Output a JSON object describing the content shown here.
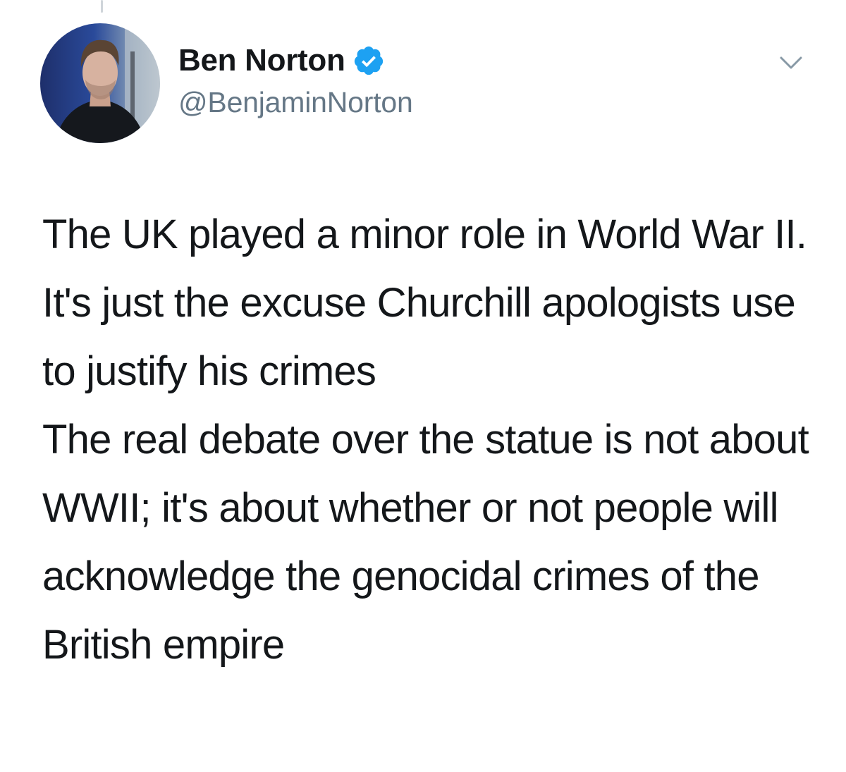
{
  "author": {
    "display_name": "Ben Norton",
    "handle": "@BenjaminNorton",
    "verified": true
  },
  "tweet": {
    "paragraphs": [
      "The UK played a minor role in World War II. It's just the excuse Churchill apologists use to justify his crimes",
      "The real debate over the statue is not about WWII; it's about whether or not people will acknowledge the genocidal crimes of the British empire"
    ]
  },
  "icons": {
    "verified": "verified-badge-icon",
    "menu": "chevron-down-icon"
  },
  "colors": {
    "text": "#14171a",
    "secondary_text": "#657786",
    "verified_blue": "#1da1f2",
    "thread_line": "#cfd5da"
  }
}
